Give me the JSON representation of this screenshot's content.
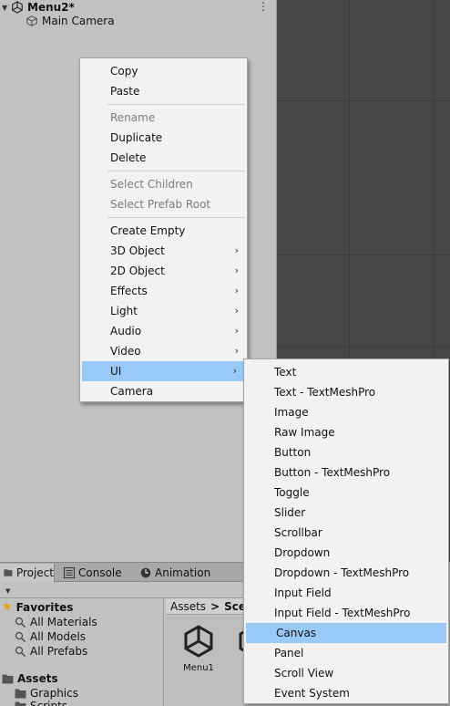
{
  "hierarchy": {
    "scene_name": "Menu2*",
    "scene_menu_icon": "⋮",
    "items": [
      "Main Camera"
    ]
  },
  "context_menu": {
    "items": [
      {
        "label": "Copy",
        "enabled": true
      },
      {
        "label": "Paste",
        "enabled": true
      },
      {
        "separator": true
      },
      {
        "label": "Rename",
        "enabled": false
      },
      {
        "label": "Duplicate",
        "enabled": true
      },
      {
        "label": "Delete",
        "enabled": true
      },
      {
        "separator": true
      },
      {
        "label": "Select Children",
        "enabled": false
      },
      {
        "label": "Select Prefab Root",
        "enabled": false
      },
      {
        "separator": true
      },
      {
        "label": "Create Empty",
        "enabled": true
      },
      {
        "label": "3D Object",
        "enabled": true,
        "submenu": true
      },
      {
        "label": "2D Object",
        "enabled": true,
        "submenu": true
      },
      {
        "label": "Effects",
        "enabled": true,
        "submenu": true
      },
      {
        "label": "Light",
        "enabled": true,
        "submenu": true
      },
      {
        "label": "Audio",
        "enabled": true,
        "submenu": true
      },
      {
        "label": "Video",
        "enabled": true,
        "submenu": true
      },
      {
        "label": "UI",
        "enabled": true,
        "submenu": true,
        "highlighted": true
      },
      {
        "label": "Camera",
        "enabled": true
      }
    ],
    "chevron": "›"
  },
  "ui_submenu": {
    "items": [
      {
        "label": "Text"
      },
      {
        "label": "Text - TextMeshPro"
      },
      {
        "label": "Image"
      },
      {
        "label": "Raw Image"
      },
      {
        "label": "Button"
      },
      {
        "label": "Button - TextMeshPro"
      },
      {
        "label": "Toggle"
      },
      {
        "label": "Slider"
      },
      {
        "label": "Scrollbar"
      },
      {
        "label": "Dropdown"
      },
      {
        "label": "Dropdown - TextMeshPro"
      },
      {
        "label": "Input Field"
      },
      {
        "label": "Input Field - TextMeshPro"
      },
      {
        "label": "Canvas",
        "highlighted": true
      },
      {
        "label": "Panel"
      },
      {
        "label": "Scroll View"
      },
      {
        "label": "Event System"
      }
    ]
  },
  "bottom_panel": {
    "tabs": [
      {
        "label": "Project",
        "icon": "folder-icon",
        "active": true
      },
      {
        "label": "Console",
        "icon": "console-icon"
      },
      {
        "label": "Animation",
        "icon": "animation-icon"
      }
    ],
    "favorites": {
      "label": "Favorites",
      "items": [
        "All Materials",
        "All Models",
        "All Prefabs"
      ]
    },
    "assets": {
      "label": "Assets",
      "items": [
        "Graphics",
        "Scripts"
      ]
    },
    "breadcrumb": {
      "root": "Assets",
      "separator": ">",
      "current": "Sce"
    },
    "grid_items": [
      {
        "label": "Menu1"
      },
      {
        "label": "M"
      }
    ]
  },
  "colors": {
    "highlight": "#99c9f7",
    "menu_bg": "#f2f2f2",
    "scene_bg": "#474747",
    "panel_bg": "#c2c2c2",
    "star": "#e8a200"
  }
}
